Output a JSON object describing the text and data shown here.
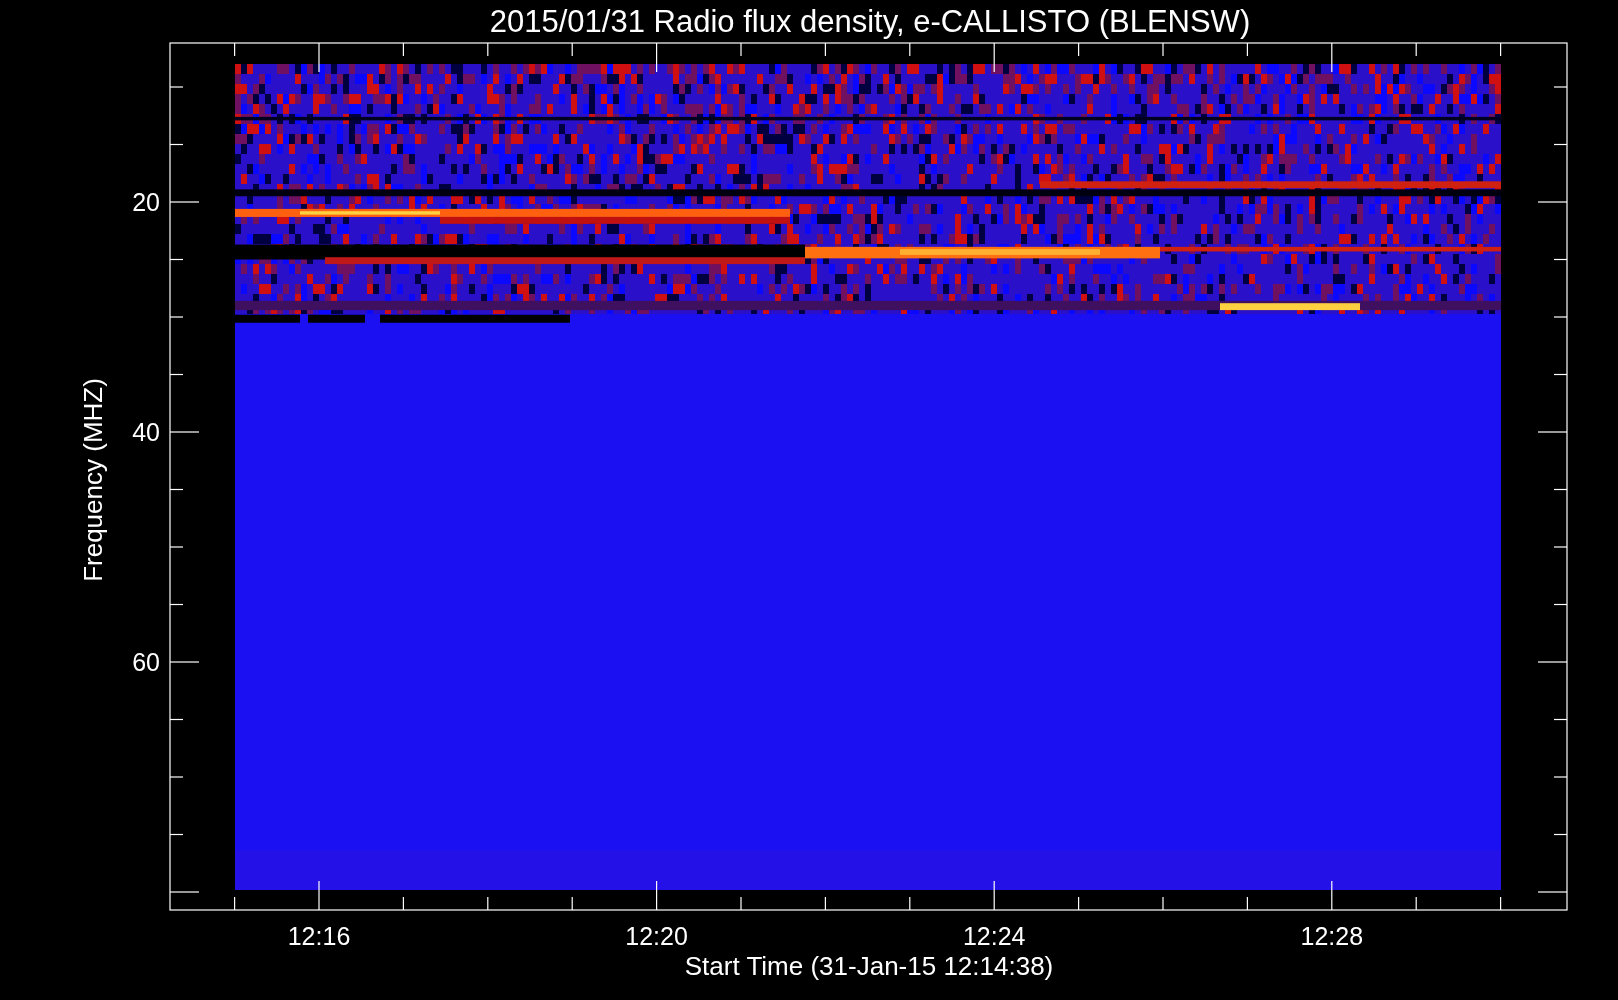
{
  "title": "2015/01/31  Radio flux density, e-CALLISTO (BLENSW)",
  "ylabel": "Frequency (MHZ)",
  "xlabel": "Start Time (31-Jan-15 12:14:38)",
  "yticks": [
    "20",
    "40",
    "60"
  ],
  "xticks": [
    "12:16",
    "12:20",
    "12:24",
    "12:28"
  ],
  "spectrogram": {
    "kind": "picture"
  }
}
